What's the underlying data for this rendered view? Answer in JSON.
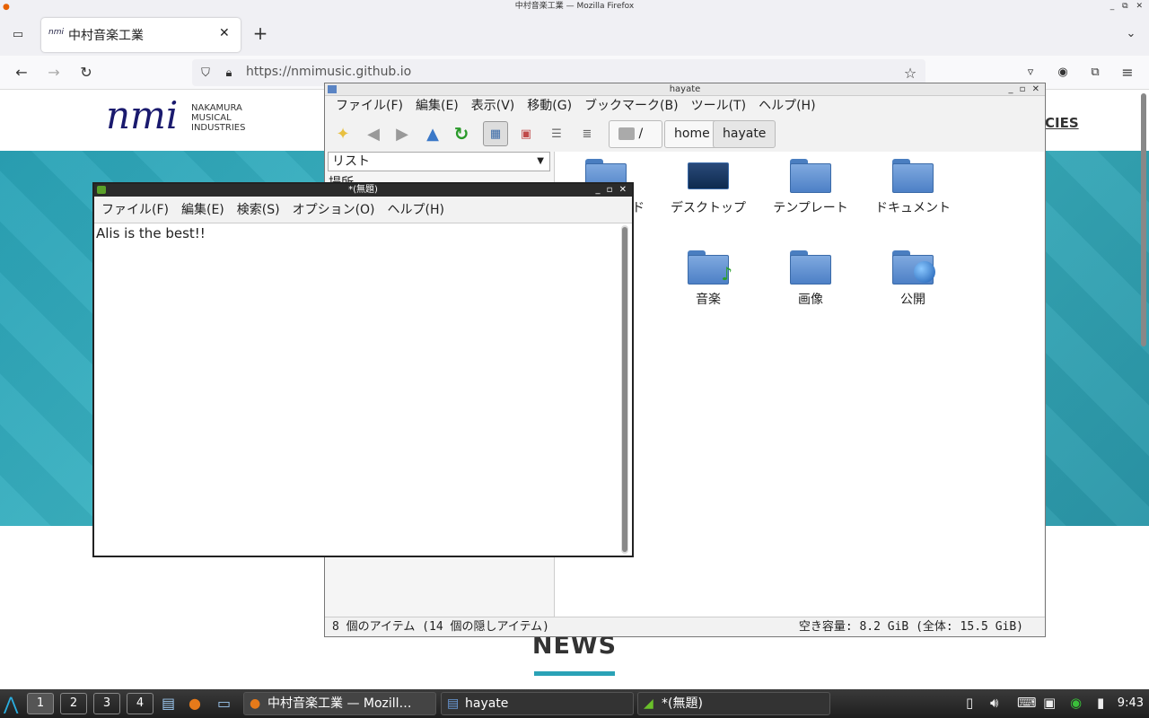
{
  "firefox": {
    "window_title": "中村音楽工業 — Mozilla Firefox",
    "tab_title": "中村音楽工業",
    "tab_favicon_text": "nmi",
    "url": "https://nmimusic.github.io"
  },
  "website": {
    "logo_mark": "nmi",
    "logo_lines": [
      "NAKAMURA",
      "MUSICAL",
      "INDUSTRIES"
    ],
    "nav_partial": "CIES",
    "news_heading": "NEWS",
    "accent_color": "#2aa2b6"
  },
  "file_manager": {
    "title": "hayate",
    "menu": [
      "ファイル(F)",
      "編集(E)",
      "表示(V)",
      "移動(G)",
      "ブックマーク(B)",
      "ツール(T)",
      "ヘルプ(H)"
    ],
    "breadcrumbs": [
      "/",
      "home",
      "hayate"
    ],
    "side_combo": "リスト",
    "side_label": "場所",
    "items": [
      {
        "name": "ド",
        "icon": "download-folder-icon"
      },
      {
        "name": "デスクトップ",
        "icon": "desktop-folder-icon"
      },
      {
        "name": "テンプレート",
        "icon": "folder-icon"
      },
      {
        "name": "ドキュメント",
        "icon": "documents-folder-icon"
      },
      {
        "name": "音楽",
        "icon": "music-folder-icon"
      },
      {
        "name": "画像",
        "icon": "pictures-folder-icon"
      },
      {
        "name": "公開",
        "icon": "public-folder-icon"
      }
    ],
    "status_left": "8 個のアイテム (14 個の隠しアイテム)",
    "status_right": "空き容量: 8.2 GiB (全体: 15.5 GiB)"
  },
  "leafpad": {
    "title": "*(無題)",
    "menu": [
      "ファイル(F)",
      "編集(E)",
      "検索(S)",
      "オプション(O)",
      "ヘルプ(H)"
    ],
    "content": "Alis is the best!!"
  },
  "taskbar": {
    "workspaces": [
      "1",
      "2",
      "3",
      "4"
    ],
    "tasks": [
      "中村音楽工業 — Mozill…",
      "hayate",
      "*(無題)"
    ],
    "clock": "9:43"
  }
}
